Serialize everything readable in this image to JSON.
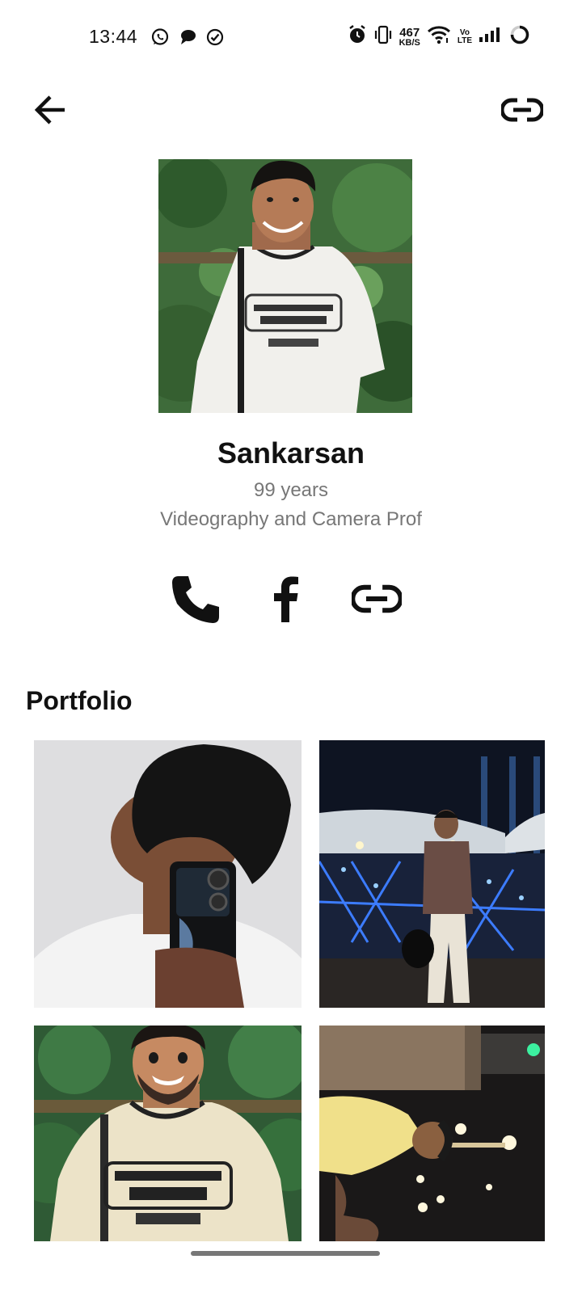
{
  "status_bar": {
    "time": "13:44",
    "net_speed_value": "467",
    "net_speed_unit": "KB/S",
    "volte_top": "Vo",
    "volte_bottom": "LTE",
    "icons": [
      "whatsapp-icon",
      "chat-icon",
      "check-circle-icon",
      "alarm-icon",
      "vibrate-icon",
      "wifi-icon",
      "signal-icon",
      "battery-icon"
    ]
  },
  "app_bar": {
    "back_icon": "arrow-left-icon",
    "link_icon": "link-icon"
  },
  "profile": {
    "name": "Sankarsan",
    "age": "99 years",
    "profession": "Videography and Camera Prof"
  },
  "contacts": {
    "icons": [
      "phone-icon",
      "facebook-icon",
      "link-icon"
    ]
  },
  "portfolio": {
    "title": "Portfolio",
    "images": [
      {
        "label": "mirror selfie with phone"
      },
      {
        "label": "night photo at lit stadium"
      },
      {
        "label": "cartoon portrait illustration"
      },
      {
        "label": "night photo in yellow shirt"
      }
    ]
  },
  "colors": {
    "text_primary": "#111111",
    "text_secondary": "#777777",
    "background": "#ffffff"
  }
}
